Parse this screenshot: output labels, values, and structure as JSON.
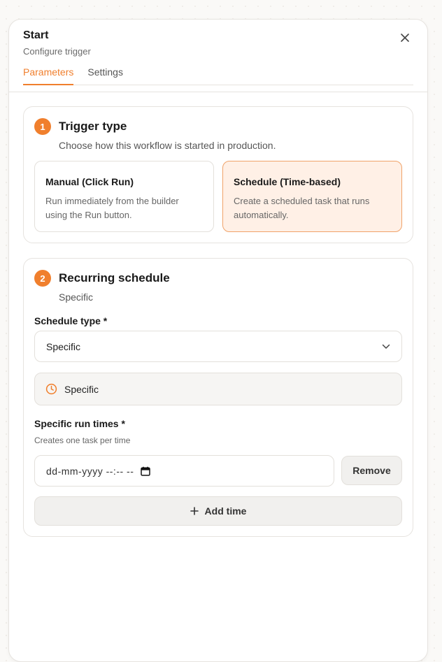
{
  "header": {
    "title": "Start",
    "subtitle": "Configure trigger"
  },
  "tabs": [
    {
      "label": "Parameters",
      "active": true
    },
    {
      "label": "Settings",
      "active": false
    }
  ],
  "trigger_type": {
    "step": "1",
    "title": "Trigger type",
    "description": "Choose how this workflow is started in production.",
    "options": [
      {
        "title": "Manual (Click Run)",
        "description": "Run immediately from the builder using the Run button.",
        "selected": false
      },
      {
        "title": "Schedule (Time-based)",
        "description": "Create a scheduled task that runs automatically.",
        "selected": true
      }
    ]
  },
  "recurring": {
    "step": "2",
    "title": "Recurring schedule",
    "description": "Specific",
    "schedule_type_label": "Schedule type *",
    "schedule_type_value": "Specific",
    "info_text": "Specific",
    "run_times_label": "Specific run times *",
    "run_times_hint": "Creates one task per time",
    "datetime_placeholder": "dd-mm-yyyy --:-- --",
    "remove_label": "Remove",
    "add_time_label": "Add time"
  },
  "colors": {
    "accent": "#f07f2d",
    "selected_bg": "#fff0e6"
  },
  "icons": {
    "close": "close-icon",
    "chevron": "chevron-down-icon",
    "clock": "clock-icon",
    "calendar": "calendar-icon",
    "plus": "plus-icon"
  }
}
